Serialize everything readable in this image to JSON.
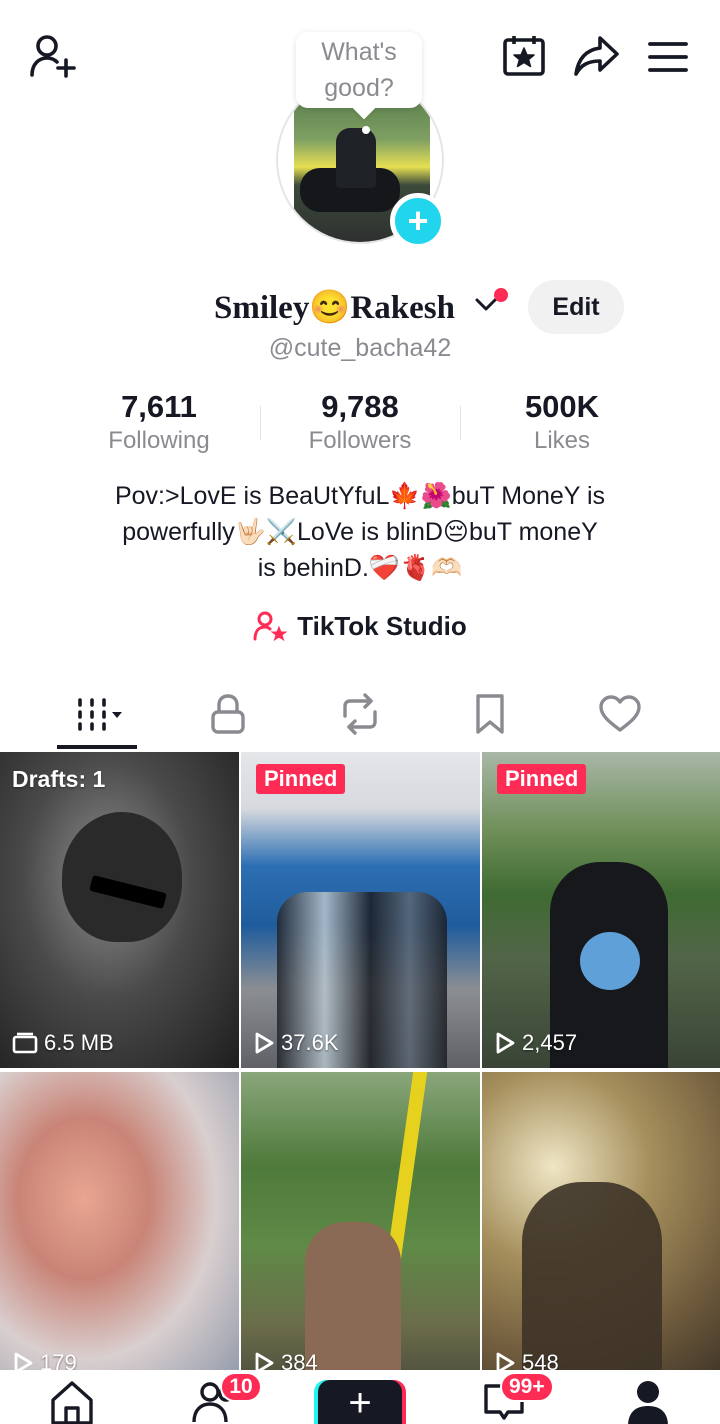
{
  "header": {
    "add_friend_icon": "add-user-icon",
    "calendar_icon": "calendar-star-icon",
    "share_icon": "share-icon",
    "menu_icon": "menu-icon"
  },
  "note_bubble": {
    "line1": "What's",
    "line2": "good?"
  },
  "profile": {
    "name": "Smiley😊Rakesh",
    "handle": "@cute_bacha42",
    "edit_label": "Edit"
  },
  "stats": [
    {
      "value": "7,611",
      "label": "Following"
    },
    {
      "value": "9,788",
      "label": "Followers"
    },
    {
      "value": "500K",
      "label": "Likes"
    }
  ],
  "bio": {
    "line1": "Pov:>LovE is BeaUtYfuL🍁🌺buT MoneY is",
    "line2": "powerfully🤟🏻⚔️LoVe is blinD😔buT moneY",
    "line3": "is behinD.❤️‍🩹🫀🫶🏻"
  },
  "studio": {
    "label": "TikTok Studio"
  },
  "tabs": [
    "videos",
    "private",
    "reposts",
    "saved",
    "liked"
  ],
  "grid": [
    {
      "overlay": "Drafts: 1",
      "stat": "6.5 MB",
      "kind": "draft"
    },
    {
      "overlay": "Pinned",
      "stat": "37.6K",
      "kind": "video"
    },
    {
      "overlay": "Pinned",
      "stat": "2,457",
      "kind": "video"
    },
    {
      "overlay": "",
      "stat": "179",
      "kind": "video"
    },
    {
      "overlay": "",
      "stat": "384",
      "kind": "video"
    },
    {
      "overlay": "",
      "stat": "548",
      "kind": "video"
    }
  ],
  "bottom_nav": {
    "friends_badge": "10",
    "inbox_badge": "99+",
    "create_label": "+"
  },
  "colors": {
    "accent": "#fe2c55",
    "cyan": "#20d5ec",
    "text": "#161823",
    "muted": "#8a8b91"
  }
}
